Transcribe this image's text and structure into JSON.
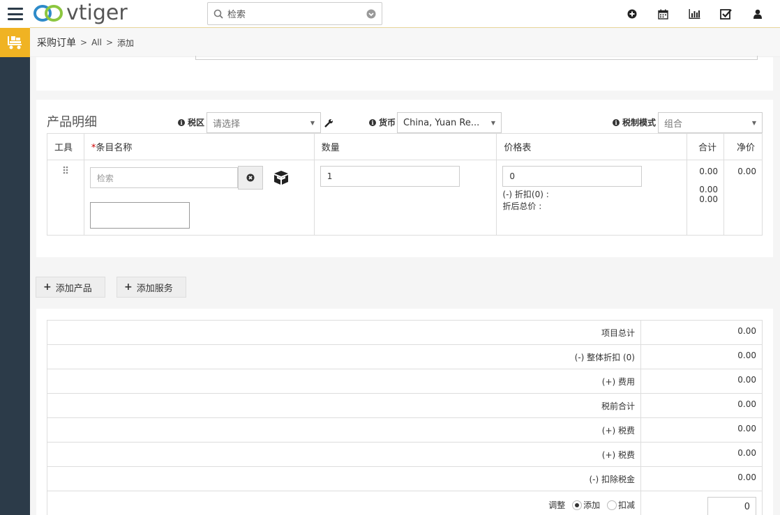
{
  "app": {
    "logo_text": "vtiger"
  },
  "search": {
    "placeholder": "检索"
  },
  "breadcrumb": {
    "module": "采购订单",
    "view": "All",
    "action": "添加"
  },
  "items": {
    "title": "产品明细",
    "tax_region_label": "税区",
    "tax_region_value": "请选择",
    "currency_label": "货币",
    "currency_value": "China, Yuan Re...",
    "tax_mode_label": "税制模式",
    "tax_mode_value": "组合",
    "columns": {
      "tools": "工具",
      "item_name": "条目名称",
      "quantity": "数量",
      "price_list": "价格表",
      "total": "合计",
      "net_price": "净价"
    },
    "row": {
      "item_placeholder": "检索",
      "quantity": "1",
      "price": "0",
      "discount_label": "(-) 折扣(0) :",
      "after_discount_label": "折后总价 :",
      "total": "0.00",
      "discount_value": "0.00",
      "after_discount_value": "0.00",
      "net_price": "0.00"
    }
  },
  "buttons": {
    "add_product": "添加产品",
    "add_service": "添加服务"
  },
  "totals": {
    "rows": [
      {
        "label": "项目总计",
        "value": "0.00"
      },
      {
        "label": "(-) 整体折扣 (0)",
        "value": "0.00"
      },
      {
        "label": "(+) 费用",
        "value": "0.00"
      },
      {
        "label": "税前合计",
        "value": "0.00"
      },
      {
        "label": "(+) 税费",
        "value": "0.00"
      },
      {
        "label": "(+) 税费",
        "value": "0.00"
      },
      {
        "label": "(-) 扣除税金",
        "value": "0.00"
      }
    ],
    "adjustment_label": "调整",
    "adjust_add": "添加",
    "adjust_deduct": "扣减",
    "adjustment_value": "0"
  },
  "colors": {
    "accent": "#f0b323",
    "rail": "#2c3b49"
  },
  "icons": [
    "menu-icon",
    "purchase-order-icon",
    "search-icon",
    "add-icon",
    "calendar-icon",
    "reports-icon",
    "tasks-icon",
    "user-icon",
    "wrench-icon",
    "drag-icon",
    "clear-icon",
    "box-icon"
  ]
}
